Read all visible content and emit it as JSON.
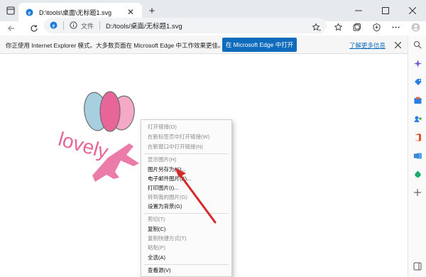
{
  "tab": {
    "title": "D:\\tools\\桌面\\无标题1.svg",
    "favicon": "edge-ie-mode-icon"
  },
  "window_buttons": [
    "minimize",
    "restore",
    "close"
  ],
  "address_bar": {
    "scheme_label": "文件",
    "url": "D:/tools/桌面/无标题1.svg"
  },
  "ie_banner": {
    "message": "你正使用 Internet Explorer 模式。大多数页面在 Microsoft Edge 中工作效果更佳。",
    "open_button": "在 Microsoft Edge 中打开",
    "learn_more": "了解更多信息"
  },
  "artwork": {
    "text": "lovely",
    "colors": {
      "pink": "#e8659a",
      "light_pink": "#f4a9c6",
      "blue": "#a8cfe0",
      "outline": "#6d6d6d"
    }
  },
  "context_menu": {
    "items": [
      {
        "label": "打开链接(O)",
        "enabled": false
      },
      {
        "label": "在新标签页中打开链接(W)",
        "enabled": false
      },
      {
        "label": "在新窗口中打开链接(N)",
        "enabled": false
      },
      {
        "label": "显示图片(H)",
        "enabled": false
      },
      {
        "label": "图片另存为(S)...",
        "enabled": true
      },
      {
        "label": "电子邮件图片(E)...",
        "enabled": true
      },
      {
        "label": "打印图片(I)...",
        "enabled": true
      },
      {
        "label": "转到我的图片(G)",
        "enabled": false
      },
      {
        "label": "设置为背景(G)",
        "enabled": true
      },
      {
        "label": "剪切(T)",
        "enabled": false
      },
      {
        "label": "复制(C)",
        "enabled": true
      },
      {
        "label": "复制快捷方式(T)",
        "enabled": false
      },
      {
        "label": "粘贴(P)",
        "enabled": false
      },
      {
        "label": "全选(A)",
        "enabled": true
      },
      {
        "label": "查看源(V)",
        "enabled": true
      }
    ]
  },
  "annotation_color": "#d42a2a"
}
